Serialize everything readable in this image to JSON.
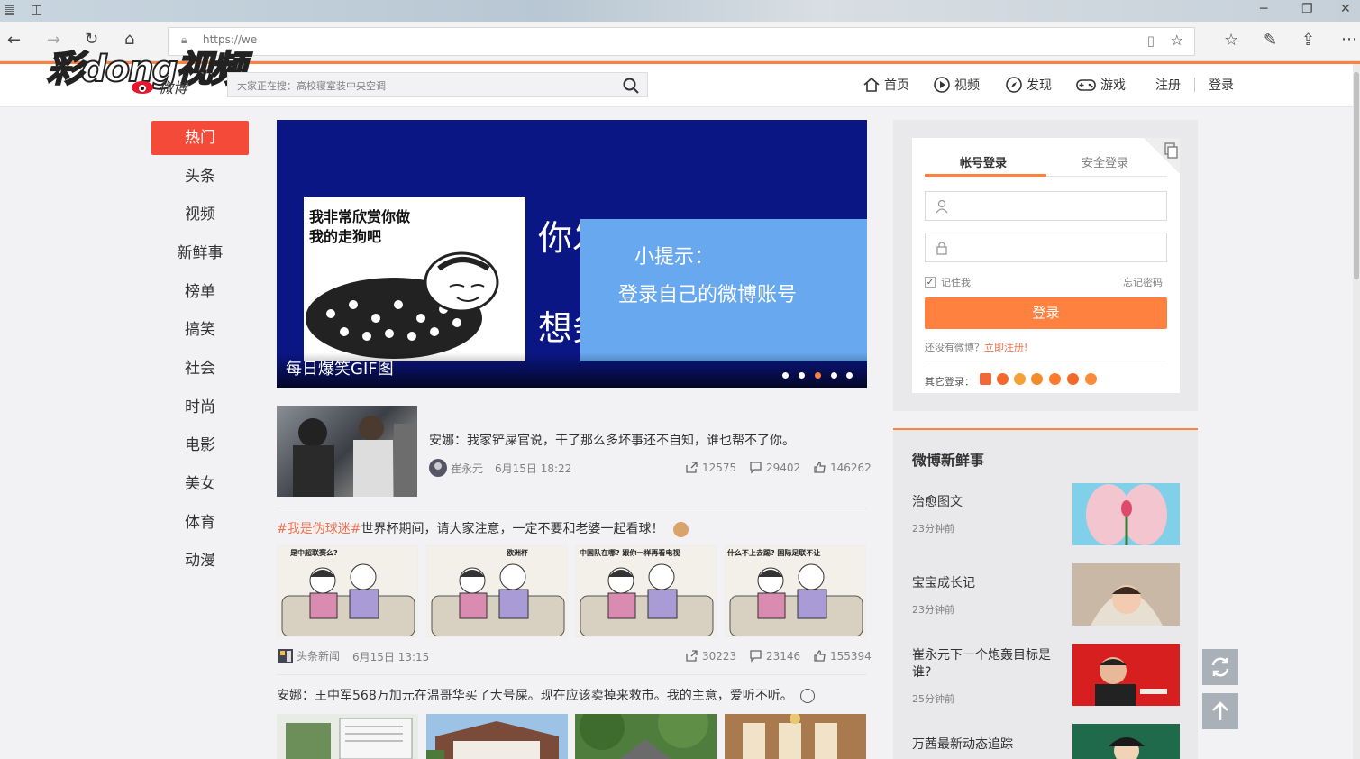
{
  "browser": {
    "url": "https://we",
    "window_controls": [
      "minimize",
      "restore",
      "close"
    ]
  },
  "watermark": {
    "brand": "彩dong视频"
  },
  "header": {
    "logo_sub": "微博",
    "search_placeholder": "大家正在搜：高校寝室装中央空调",
    "nav": [
      {
        "label": "首页",
        "icon": "home-icon"
      },
      {
        "label": "视频",
        "icon": "video-icon"
      },
      {
        "label": "发现",
        "icon": "compass-icon"
      },
      {
        "label": "游戏",
        "icon": "gamepad-icon"
      }
    ],
    "register": "注册",
    "login": "登录"
  },
  "left_nav": [
    "热门",
    "头条",
    "视频",
    "新鲜事",
    "榜单",
    "搞笑",
    "社会",
    "时尚",
    "电影",
    "美女",
    "体育",
    "动漫"
  ],
  "banner": {
    "meme_text": "我非常欣赏你做我的走狗吧",
    "big_text_1": "你发",
    "big_text_2": "想务",
    "tip_title": "小提示：",
    "tip_body": "登录自己的微博账号",
    "caption": "每日爆笑GIF图",
    "dots": 5,
    "active_dot": 3
  },
  "feed": [
    {
      "text": "安娜：我家铲屎官说，干了那么多坏事还不自知，谁也帮不了你。",
      "author": "崔永元",
      "time": "6月15日 18:22",
      "shares": "12575",
      "comments": "29402",
      "likes": "146262"
    },
    {
      "hashtag": "#我是伪球迷#",
      "text": "世界杯期间，请大家注意，一定不要和老婆一起看球！",
      "comic_captions": [
        "是中超联赛么?",
        "欧洲杯",
        "中国队在哪?  跟你一样再看电视",
        "什么不上去踢?  国际足联不让"
      ],
      "author": "头条新闻",
      "time": "6月15日 13:15",
      "shares": "30223",
      "comments": "23146",
      "likes": "155394"
    },
    {
      "text": "安娜：王中军568万加元在温哥华买了大号屎。现在应该卖掉来救市。我的主意，爱听不听。"
    }
  ],
  "login": {
    "tab_account": "帐号登录",
    "tab_secure": "安全登录",
    "remember": "记住我",
    "forgot": "忘记密码",
    "button": "登录",
    "no_account": "还没有微博？",
    "register_now": "立即注册!",
    "other_login": "其它登录："
  },
  "news": {
    "title": "微博新鲜事",
    "items": [
      {
        "title": "治愈图文",
        "time": "23分钟前"
      },
      {
        "title": "宝宝成长记",
        "time": "23分钟前"
      },
      {
        "title": "崔永元下一个炮轰目标是谁?",
        "time": "25分钟前"
      },
      {
        "title": "万茜最新动态追踪",
        "time": ""
      }
    ]
  },
  "colors": {
    "accent": "#ff8140",
    "hot_red": "#f44a3a",
    "banner_bg": "#0b1685",
    "tip_bg": "#68a8ee"
  }
}
